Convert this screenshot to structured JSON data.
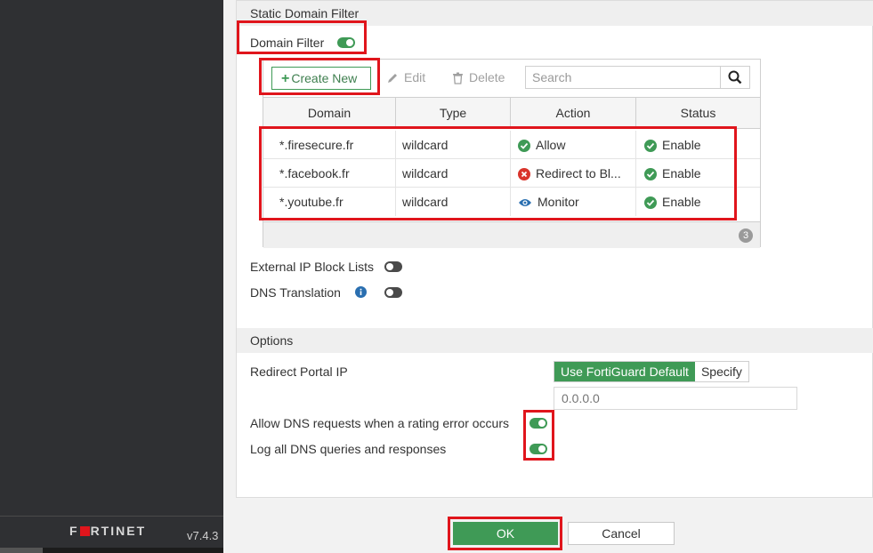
{
  "sidebar": {
    "logo_text": "F⬛RTINET",
    "version": "v7.4.3"
  },
  "static_domain_filter": {
    "section_title": "Static Domain Filter",
    "domain_filter_label": "Domain Filter",
    "domain_filter_enabled": true,
    "toolbar": {
      "create_new": "Create New",
      "edit": "Edit",
      "delete": "Delete",
      "search_placeholder": "Search"
    },
    "table": {
      "headers": [
        "Domain",
        "Type",
        "Action",
        "Status"
      ],
      "rows": [
        {
          "domain": "*.firesecure.fr",
          "type": "wildcard",
          "action": "Allow",
          "action_icon": "check-circle-icon",
          "status": "Enable"
        },
        {
          "domain": "*.facebook.fr",
          "type": "wildcard",
          "action": "Redirect to Bl...",
          "action_icon": "x-circle-icon",
          "status": "Enable"
        },
        {
          "domain": "*.youtube.fr",
          "type": "wildcard",
          "action": "Monitor",
          "action_icon": "eye-icon",
          "status": "Enable"
        }
      ],
      "count": "3"
    },
    "external_ip_block_lists_label": "External IP Block Lists",
    "external_ip_block_lists_enabled": false,
    "dns_translation_label": "DNS Translation",
    "dns_translation_enabled": false
  },
  "options": {
    "section_title": "Options",
    "redirect_portal_ip_label": "Redirect Portal IP",
    "redirect_options": [
      "Use FortiGuard Default",
      "Specify"
    ],
    "redirect_selected": "Use FortiGuard Default",
    "ip_placeholder": "0.0.0.0",
    "allow_dns_rating_error_label": "Allow DNS requests when a rating error occurs",
    "allow_dns_rating_error_enabled": true,
    "log_dns_label": "Log all DNS queries and responses",
    "log_dns_enabled": true
  },
  "footer": {
    "ok": "OK",
    "cancel": "Cancel"
  },
  "colors": {
    "accent_green": "#3f9a56",
    "highlight_red": "#e0151c",
    "deny_red": "#d9342b",
    "monitor_blue": "#2a6fb0"
  }
}
